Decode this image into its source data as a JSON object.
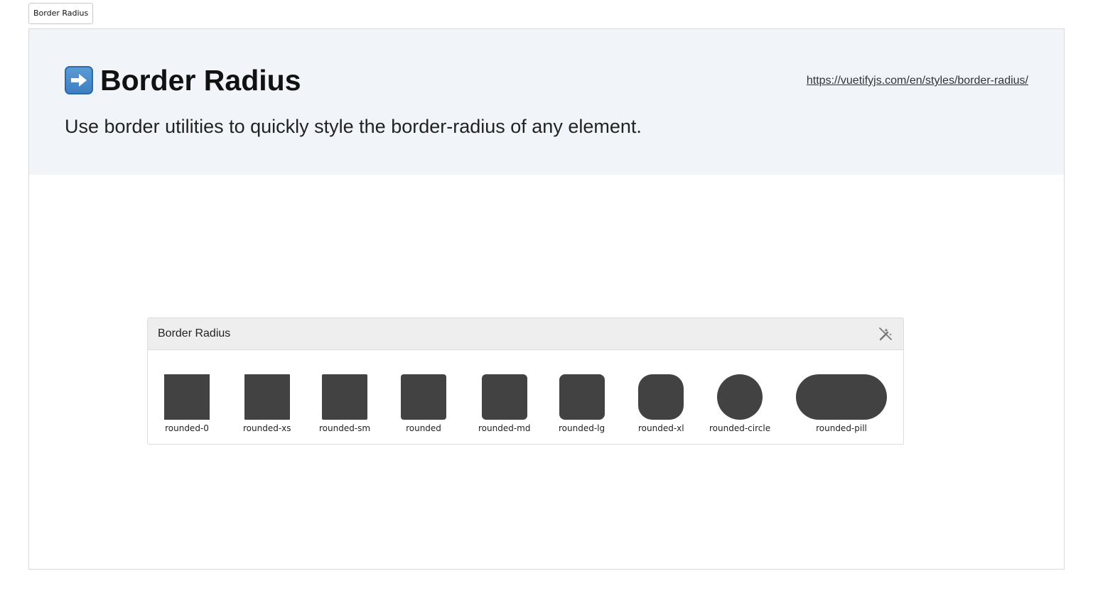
{
  "browser_tab": {
    "label": "Border Radius"
  },
  "hero": {
    "icon": "right-arrow-icon",
    "title": "Border Radius",
    "link": "https://vuetifyjs.com/en/styles/border-radius/",
    "description": "Use border utilities to quickly style the border-radius of any element."
  },
  "card": {
    "title": "Border Radius",
    "action_icon": "magic-wand-off-icon",
    "samples": [
      {
        "label": "rounded-0"
      },
      {
        "label": "rounded-xs"
      },
      {
        "label": "rounded-sm"
      },
      {
        "label": "rounded"
      },
      {
        "label": "rounded-md"
      },
      {
        "label": "rounded-lg"
      },
      {
        "label": "rounded-xl"
      },
      {
        "label": "rounded-circle"
      },
      {
        "label": "rounded-pill"
      }
    ]
  },
  "colors": {
    "hero_background": "#f1f5fa",
    "swatch": "#424242",
    "card_header": "#eeeeee"
  }
}
